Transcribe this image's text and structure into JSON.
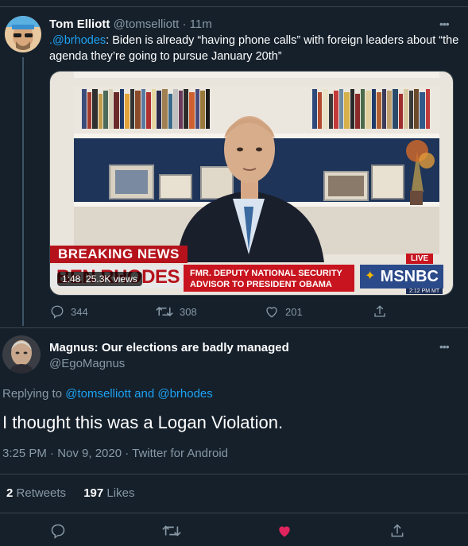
{
  "tweet1": {
    "author_name": "Tom Elliott",
    "handle": "@tomselliott",
    "time": "· 11m",
    "mention": ".@brhodes",
    "text_rest": ": Biden is already “having phone calls” with foreign leaders about “the agenda they’re going to pursue January 20th”",
    "video": {
      "breaking_label": "BREAKING NEWS",
      "chyron_name": "BEN RHODES",
      "chyron_desc_1": "FMR. DEPUTY NATIONAL SECURITY",
      "chyron_desc_2": "ADVISOR TO PRESIDENT OBAMA",
      "live_label": "LIVE",
      "network": "MSNBC",
      "clock": "2:12 PM MT",
      "duration": "1:48",
      "views": "25.3K views"
    },
    "actions": {
      "replies": "344",
      "retweets": "308",
      "likes": "201"
    }
  },
  "tweet2": {
    "author_name": "Magnus: Our elections are badly managed",
    "handle": "@EgoMagnus",
    "replying_prefix": "Replying to",
    "replying_user1": "@tomselliott",
    "replying_and": "and",
    "replying_user2": "@brhodes",
    "text": "I thought this was a Logan Violation.",
    "timestamp": "3:25 PM · Nov 9, 2020 · Twitter for Android",
    "retweet_count": "2",
    "retweet_label": "Retweets",
    "like_count": "197",
    "like_label": "Likes",
    "liked": true
  },
  "colors": {
    "background": "#15202b",
    "border": "#38444d",
    "muted": "#8899a6",
    "link": "#1da1f2",
    "like_active": "#e0245e",
    "breaking_red": "#b5121b"
  },
  "icons": [
    "more-icon",
    "reply-icon",
    "retweet-icon",
    "like-icon",
    "share-icon"
  ]
}
